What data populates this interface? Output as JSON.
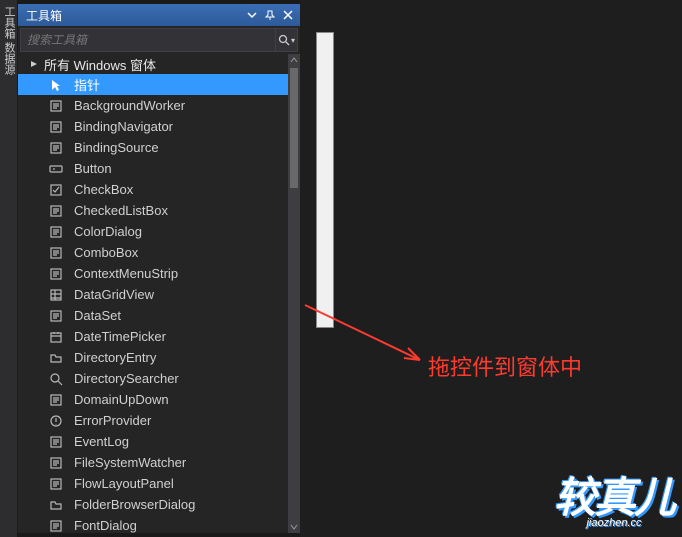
{
  "leftStrip": "工具箱 数据源",
  "panel": {
    "title": "工具箱",
    "search_placeholder": "搜索工具箱"
  },
  "category": {
    "label": "所有 Windows 窗体"
  },
  "tools": [
    {
      "label": "指针",
      "selected": true,
      "icon": "pointer"
    },
    {
      "label": "BackgroundWorker",
      "icon": "gear"
    },
    {
      "label": "BindingNavigator",
      "icon": "nav"
    },
    {
      "label": "BindingSource",
      "icon": "db"
    },
    {
      "label": "Button",
      "icon": "button"
    },
    {
      "label": "CheckBox",
      "icon": "checkbox"
    },
    {
      "label": "CheckedListBox",
      "icon": "checklist"
    },
    {
      "label": "ColorDialog",
      "icon": "palette"
    },
    {
      "label": "ComboBox",
      "icon": "combo"
    },
    {
      "label": "ContextMenuStrip",
      "icon": "menu"
    },
    {
      "label": "DataGridView",
      "icon": "grid"
    },
    {
      "label": "DataSet",
      "icon": "dataset"
    },
    {
      "label": "DateTimePicker",
      "icon": "calendar"
    },
    {
      "label": "DirectoryEntry",
      "icon": "folder"
    },
    {
      "label": "DirectorySearcher",
      "icon": "search"
    },
    {
      "label": "DomainUpDown",
      "icon": "updown"
    },
    {
      "label": "ErrorProvider",
      "icon": "error"
    },
    {
      "label": "EventLog",
      "icon": "log"
    },
    {
      "label": "FileSystemWatcher",
      "icon": "eye"
    },
    {
      "label": "FlowLayoutPanel",
      "icon": "flow"
    },
    {
      "label": "FolderBrowserDialog",
      "icon": "folderopen"
    },
    {
      "label": "FontDialog",
      "icon": "font"
    }
  ],
  "annotation": "拖控件到窗体中",
  "watermark": {
    "main": "较真儿",
    "sub": "jiaozhen.cc"
  }
}
